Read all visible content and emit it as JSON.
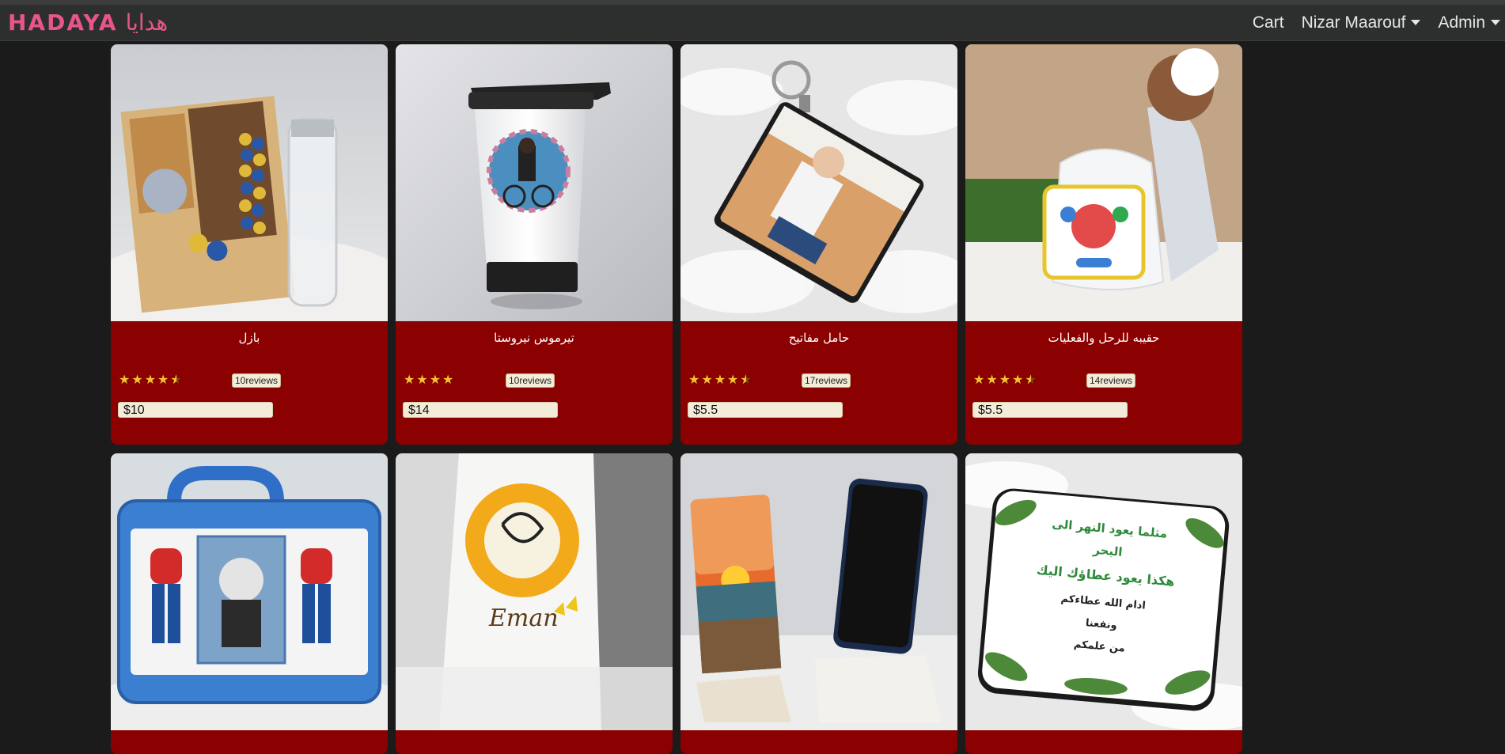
{
  "brand": {
    "latin": "HADAYA",
    "arabic": "هدايا"
  },
  "nav": {
    "cart": "Cart",
    "user": "Nizar Maarouf",
    "admin": "Admin"
  },
  "products": [
    {
      "name": "بازل",
      "rating": 4.5,
      "reviews": "10reviews",
      "price": "$10",
      "image": "puzzle-photo"
    },
    {
      "name": "تيرموس نيروستا",
      "rating": 4,
      "reviews": "10reviews",
      "price": "$14",
      "image": "thermos-mug"
    },
    {
      "name": "حامل مفاتيح",
      "rating": 4.5,
      "reviews": "17reviews",
      "price": "$5.5",
      "image": "keychain-photo"
    },
    {
      "name": "حقيبه للرحل والفعليات",
      "rating": 4.5,
      "reviews": "14reviews",
      "price": "$5.5",
      "image": "drawstring-bag"
    },
    {
      "name": "",
      "image": "lunch-box-spiderman"
    },
    {
      "name": "",
      "image": "tote-bag-eman"
    },
    {
      "name": "",
      "image": "phone-stands"
    },
    {
      "name": "",
      "image": "coaster-arabic-text"
    }
  ],
  "images_text": {
    "tote_name": "Eman",
    "coaster_lines": [
      "مثلما يعود النهر الى",
      "البحر",
      "هكذا يعود عطاؤك اليك",
      "ادام الله عطاءكم",
      "ونفعنا",
      "من علمكم"
    ]
  }
}
